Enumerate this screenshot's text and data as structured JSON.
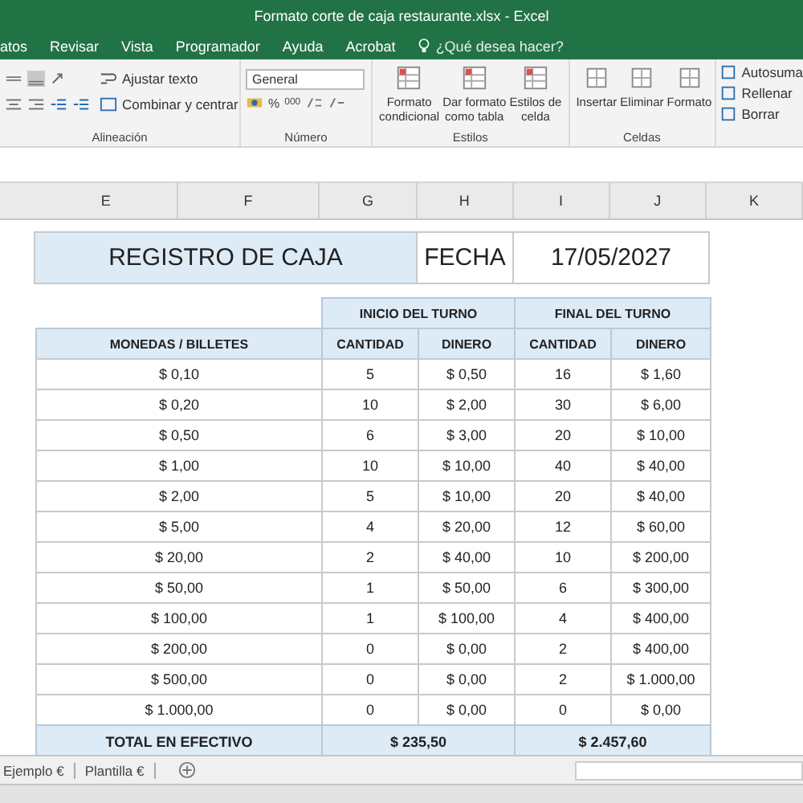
{
  "window": {
    "title": "Formato corte de caja restaurante.xlsx  -  Excel"
  },
  "ribbon_tabs": [
    {
      "label": "atos",
      "selected": false
    },
    {
      "label": "Revisar",
      "selected": false
    },
    {
      "label": "Vista",
      "selected": false
    },
    {
      "label": "Programador",
      "selected": false
    },
    {
      "label": "Ayuda",
      "selected": false
    },
    {
      "label": "Acrobat",
      "selected": false
    }
  ],
  "tell_me": {
    "placeholder": "¿Qué desea hacer?"
  },
  "alignment_group": {
    "label": "Alineación",
    "wrap_text": "Ajustar texto",
    "merge_center": "Combinar y centrar"
  },
  "number_group": {
    "label": "Número",
    "format": "General",
    "percent": "%",
    "thousands": "000"
  },
  "styles_group": {
    "label": "Estilos",
    "buttons": [
      {
        "line1": "Formato",
        "line2": "condicional"
      },
      {
        "line1": "Dar formato",
        "line2": "como tabla"
      },
      {
        "line1": "Estilos de",
        "line2": "celda"
      }
    ]
  },
  "cells_group": {
    "label": "Celdas",
    "buttons": [
      "Insertar",
      "Eliminar",
      "Formato"
    ]
  },
  "editing_group": {
    "buttons": [
      "Autosuma",
      "Rellenar",
      "Borrar"
    ]
  },
  "columns": [
    "E",
    "F",
    "G",
    "H",
    "I",
    "J",
    "K"
  ],
  "register": {
    "title": "REGISTRO DE CAJA",
    "date_label": "FECHA",
    "date": "17/05/2027"
  },
  "table": {
    "group_headers": [
      "INICIO DEL TURNO",
      "FINAL DEL TURNO"
    ],
    "columns": [
      "MONEDAS / BILLETES",
      "CANTIDAD",
      "DINERO",
      "CANTIDAD",
      "DINERO"
    ],
    "rows": [
      [
        "$ 0,10",
        "5",
        "$ 0,50",
        "16",
        "$ 1,60"
      ],
      [
        "$ 0,20",
        "10",
        "$ 2,00",
        "30",
        "$ 6,00"
      ],
      [
        "$ 0,50",
        "6",
        "$ 3,00",
        "20",
        "$ 10,00"
      ],
      [
        "$ 1,00",
        "10",
        "$ 10,00",
        "40",
        "$ 40,00"
      ],
      [
        "$ 2,00",
        "5",
        "$ 10,00",
        "20",
        "$ 40,00"
      ],
      [
        "$ 5,00",
        "4",
        "$ 20,00",
        "12",
        "$ 60,00"
      ],
      [
        "$ 20,00",
        "2",
        "$ 40,00",
        "10",
        "$ 200,00"
      ],
      [
        "$ 50,00",
        "1",
        "$ 50,00",
        "6",
        "$ 300,00"
      ],
      [
        "$ 100,00",
        "1",
        "$ 100,00",
        "4",
        "$ 400,00"
      ],
      [
        "$ 200,00",
        "0",
        "$ 0,00",
        "2",
        "$ 400,00"
      ],
      [
        "$ 500,00",
        "0",
        "$ 0,00",
        "2",
        "$ 1.000,00"
      ],
      [
        "$ 1.000,00",
        "0",
        "$ 0,00",
        "0",
        "$ 0,00"
      ]
    ],
    "total": {
      "label": "TOTAL EN EFECTIVO",
      "inicio": "$ 235,50",
      "final": "$ 2.457,60"
    }
  },
  "sheet_tabs": [
    {
      "label": "Ejemplo €",
      "selected": false
    },
    {
      "label": "Plantilla €",
      "selected": false
    }
  ]
}
